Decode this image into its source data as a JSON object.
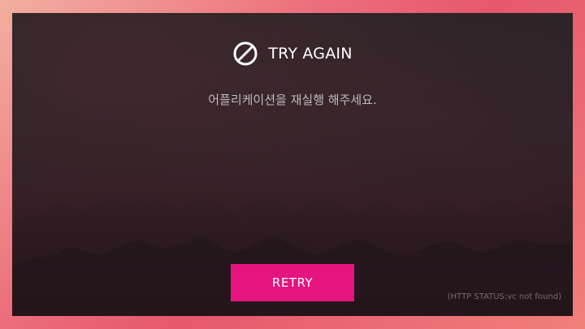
{
  "dialog": {
    "title": "TRY AGAIN",
    "icon": "prohibited-icon",
    "message": "어플리케이션을 재실행 해주세요.",
    "retry_label": "RETRY",
    "status_text": "(HTTP STATUS:vc not found)"
  },
  "colors": {
    "retry_button": "#e5147f",
    "title_text": "#ffffff",
    "message_text": "#bdbabb"
  }
}
